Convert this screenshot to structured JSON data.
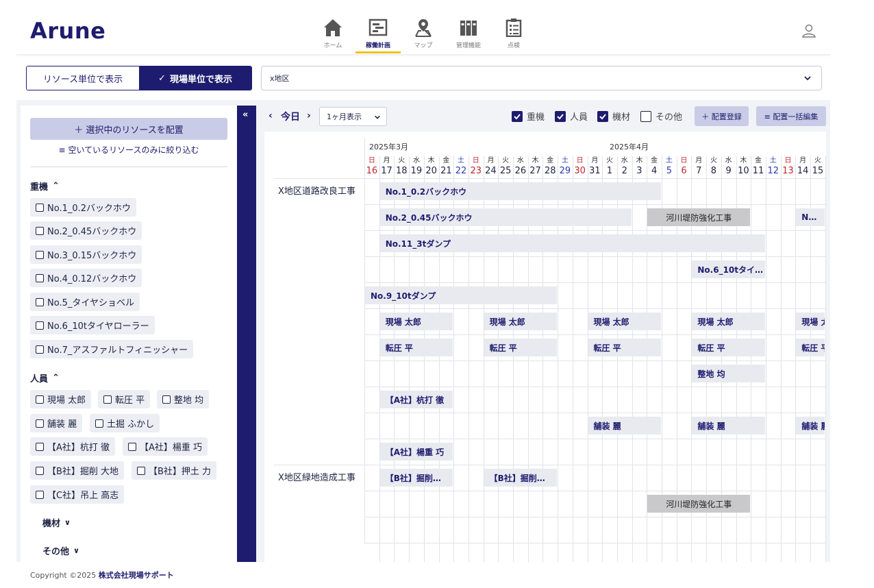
{
  "app": {
    "logo": "Arune"
  },
  "nav": [
    {
      "label": "ホーム",
      "icon": "home-icon"
    },
    {
      "label": "稼働計画",
      "icon": "schedule-icon",
      "active": true
    },
    {
      "label": "マップ",
      "icon": "map-icon"
    },
    {
      "label": "管理機能",
      "icon": "binders-icon"
    },
    {
      "label": "点検",
      "icon": "clipboard-icon"
    }
  ],
  "view_toggle": {
    "resource": "リソース単位で表示",
    "site": "現場単位で表示",
    "site_check": "✓"
  },
  "area_select": {
    "value": "x地区"
  },
  "sidebar": {
    "assign_button": "＋ 選択中のリソースを配置",
    "filter_link": "空いているリソースのみに絞り込む",
    "heavy": {
      "title": "重機",
      "items": [
        "No.1_0.2バックホウ",
        "No.2_0.45バックホウ",
        "No.3_0.15バックホウ",
        "No.4_0.12バックホウ",
        "No.5_タイヤショベル",
        "No.6_10tタイヤローラー",
        "No.7_アスファルトフィニッシャー"
      ]
    },
    "staff": {
      "title": "人員",
      "items": [
        "現場 太郎",
        "転圧 平",
        "整地 均",
        "舗装 麗",
        "土掘 ふかし",
        "【A社】杭打 徹",
        "【A社】楊重 巧",
        "【B社】掘削 大地",
        "【B社】押土 力",
        "【C社】吊上 高志"
      ]
    },
    "material": {
      "title": "機材"
    },
    "other": {
      "title": "その他"
    }
  },
  "toolbar": {
    "prev": "‹",
    "today": "今日",
    "next": "›",
    "range": "1ヶ月表示",
    "filters": [
      {
        "label": "重機",
        "checked": true
      },
      {
        "label": "人員",
        "checked": true
      },
      {
        "label": "機材",
        "checked": true
      },
      {
        "label": "その他",
        "checked": false
      }
    ],
    "register": "＋ 配置登録",
    "bulk_edit": "≡ 配置一括編集"
  },
  "calendar": {
    "months": [
      "2025年3月",
      "2025年4月"
    ],
    "days": [
      {
        "w": "日",
        "n": "16"
      },
      {
        "w": "月",
        "n": "17"
      },
      {
        "w": "火",
        "n": "18"
      },
      {
        "w": "水",
        "n": "19"
      },
      {
        "w": "木",
        "n": "20"
      },
      {
        "w": "金",
        "n": "21"
      },
      {
        "w": "土",
        "n": "22"
      },
      {
        "w": "日",
        "n": "23"
      },
      {
        "w": "月",
        "n": "24"
      },
      {
        "w": "火",
        "n": "25"
      },
      {
        "w": "水",
        "n": "26"
      },
      {
        "w": "木",
        "n": "27"
      },
      {
        "w": "金",
        "n": "28"
      },
      {
        "w": "土",
        "n": "29"
      },
      {
        "w": "日",
        "n": "30"
      },
      {
        "w": "月",
        "n": "31"
      },
      {
        "w": "火",
        "n": "1"
      },
      {
        "w": "水",
        "n": "2"
      },
      {
        "w": "木",
        "n": "3"
      },
      {
        "w": "金",
        "n": "4"
      },
      {
        "w": "土",
        "n": "5"
      },
      {
        "w": "日",
        "n": "6"
      },
      {
        "w": "月",
        "n": "7"
      },
      {
        "w": "火",
        "n": "8"
      },
      {
        "w": "水",
        "n": "9"
      },
      {
        "w": "木",
        "n": "10"
      },
      {
        "w": "金",
        "n": "11"
      },
      {
        "w": "土",
        "n": "12"
      },
      {
        "w": "日",
        "n": "13"
      },
      {
        "w": "月",
        "n": "14"
      },
      {
        "w": "火",
        "n": "15"
      }
    ]
  },
  "projects": [
    {
      "name": "X地区道路改良工事",
      "rows": [
        [
          {
            "label": "No.1_0.2バックホウ",
            "start": 1,
            "span": 19
          }
        ],
        [
          {
            "label": "No.2_0.45バックホウ",
            "start": 1,
            "span": 17
          },
          {
            "label": "河川堤防強化工事",
            "start": 19,
            "span": 7,
            "grey": true
          },
          {
            "label": "N…",
            "start": 29,
            "span": 2
          }
        ],
        [
          {
            "label": "No.11_3tダンプ",
            "start": 1,
            "span": 26
          }
        ],
        [
          {
            "label": "No.6_10tタイ…",
            "start": 22,
            "span": 5
          }
        ],
        [
          {
            "label": "No.9_10tダンプ",
            "start": 0,
            "span": 13
          }
        ],
        [
          {
            "label": "現場 太郎",
            "start": 1,
            "span": 5
          },
          {
            "label": "現場 太郎",
            "start": 8,
            "span": 5
          },
          {
            "label": "現場 太郎",
            "start": 15,
            "span": 5
          },
          {
            "label": "現場 太郎",
            "start": 22,
            "span": 5
          },
          {
            "label": "現場 太郎",
            "start": 29,
            "span": 2
          }
        ],
        [
          {
            "label": "転圧 平",
            "start": 1,
            "span": 5
          },
          {
            "label": "転圧 平",
            "start": 8,
            "span": 5
          },
          {
            "label": "転圧 平",
            "start": 15,
            "span": 5
          },
          {
            "label": "転圧 平",
            "start": 22,
            "span": 5
          },
          {
            "label": "転圧 平",
            "start": 29,
            "span": 2
          }
        ],
        [
          {
            "label": "整地 均",
            "start": 22,
            "span": 5
          }
        ],
        [
          {
            "label": "【A社】杭打 徹",
            "start": 1,
            "span": 5
          }
        ],
        [
          {
            "label": "舗装 麗",
            "start": 15,
            "span": 5
          },
          {
            "label": "舗装 麗",
            "start": 22,
            "span": 5
          },
          {
            "label": "舗装 麗",
            "start": 29,
            "span": 2
          }
        ],
        [
          {
            "label": "【A社】楊重 巧",
            "start": 1,
            "span": 5
          }
        ]
      ]
    },
    {
      "name": "X地区緑地造成工事",
      "rows": [
        [
          {
            "label": "【B社】掘削…",
            "start": 1,
            "span": 5
          },
          {
            "label": "【B社】掘削…",
            "start": 8,
            "span": 5
          }
        ],
        [
          {
            "label": "河川堤防強化工事",
            "start": 19,
            "span": 7,
            "grey": true
          }
        ],
        [],
        []
      ]
    }
  ],
  "footer": {
    "prefix": "Copyright ©2025 ",
    "company": "株式会社現場サポート"
  }
}
